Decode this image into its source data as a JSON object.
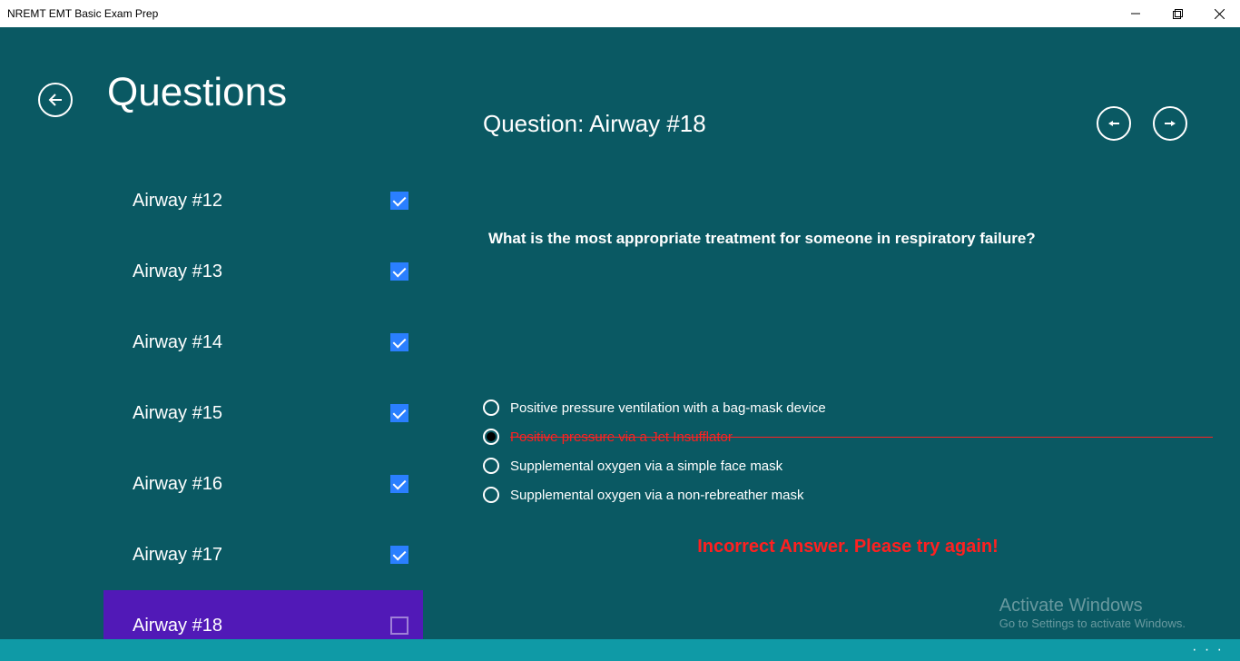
{
  "window": {
    "title": "NREMT EMT Basic Exam Prep"
  },
  "header": {
    "page_title": "Questions"
  },
  "sidebar": {
    "items": [
      {
        "label": "Airway #12",
        "checked": true,
        "selected": false
      },
      {
        "label": "Airway #13",
        "checked": true,
        "selected": false
      },
      {
        "label": "Airway #14",
        "checked": true,
        "selected": false
      },
      {
        "label": "Airway #15",
        "checked": true,
        "selected": false
      },
      {
        "label": "Airway #16",
        "checked": true,
        "selected": false
      },
      {
        "label": "Airway #17",
        "checked": true,
        "selected": false
      },
      {
        "label": "Airway #18",
        "checked": false,
        "selected": true
      }
    ]
  },
  "main": {
    "heading": "Question: Airway #18",
    "question_text": "What is the most appropriate treatment for someone in respiratory failure?",
    "answers": [
      {
        "text": "Positive pressure ventilation with a bag-mask device",
        "selected": false,
        "wrong": false
      },
      {
        "text": "Positive pressure via a Jet Insufflator",
        "selected": true,
        "wrong": true
      },
      {
        "text": "Supplemental oxygen via a simple face mask",
        "selected": false,
        "wrong": false
      },
      {
        "text": "Supplemental oxygen via a non-rebreather mask",
        "selected": false,
        "wrong": false
      }
    ],
    "feedback": "Incorrect Answer. Please try again!"
  },
  "watermark": {
    "title": "Activate Windows",
    "sub": "Go to Settings to activate Windows."
  },
  "bottombar": {
    "more": "· · ·"
  }
}
